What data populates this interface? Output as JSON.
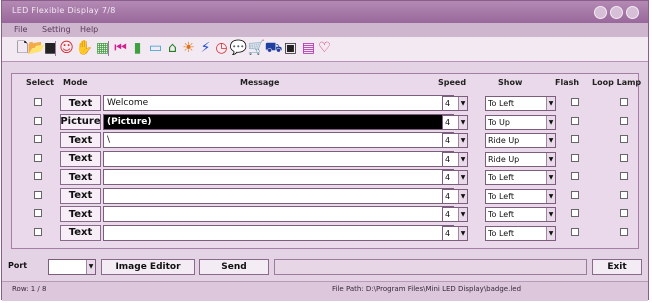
{
  "window": {
    "title": "LED Flexible Display 7/8"
  },
  "menu": [
    {
      "label": "File"
    },
    {
      "label": "Setting"
    },
    {
      "label": "Help"
    }
  ],
  "toolbar_icons": [
    {
      "name": "new-file-icon",
      "glyph": "🗋",
      "color": "#111111"
    },
    {
      "name": "open-folder-icon",
      "glyph": "📂",
      "color": "#8a6a2a"
    },
    {
      "name": "save-disk-icon",
      "glyph": "■",
      "color": "#222222"
    },
    {
      "name": "smiley-icon",
      "glyph": "☺",
      "color": "#d03030"
    },
    {
      "name": "hand-icon",
      "glyph": "✋",
      "color": "#c8a040"
    },
    {
      "name": "grid-icon",
      "glyph": "▦",
      "color": "#40a040"
    },
    {
      "name": "rewind-icon",
      "glyph": "⏮",
      "color": "#d02090"
    },
    {
      "name": "battery-icon",
      "glyph": "▮",
      "color": "#40a040"
    },
    {
      "name": "screen-icon",
      "glyph": "▭",
      "color": "#2f9fd0"
    },
    {
      "name": "house-icon",
      "glyph": "⌂",
      "color": "#208020"
    },
    {
      "name": "sun-icon",
      "glyph": "☀",
      "color": "#e07010"
    },
    {
      "name": "lightning-icon",
      "glyph": "⚡",
      "color": "#2050d0"
    },
    {
      "name": "clock-icon",
      "glyph": "◷",
      "color": "#d03030"
    },
    {
      "name": "speech-bubble-icon",
      "glyph": "💬",
      "color": "#6a40c0"
    },
    {
      "name": "cart-icon",
      "glyph": "🛒",
      "color": "#40a040"
    },
    {
      "name": "binoculars-icon",
      "glyph": "⛟",
      "color": "#2040a0"
    },
    {
      "name": "monitor-icon",
      "glyph": "▣",
      "color": "#222222"
    },
    {
      "name": "disk-icon",
      "glyph": "▤",
      "color": "#b020b0"
    },
    {
      "name": "heart-icon",
      "glyph": "♡",
      "color": "#d02060"
    }
  ],
  "columns": {
    "select": "Select",
    "mode": "Mode",
    "message": "Message",
    "speed": "Speed",
    "show": "Show",
    "flash": "Flash",
    "loop_lamp": "Loop Lamp"
  },
  "rows": [
    {
      "selected": false,
      "mode": "Text",
      "message": "Welcome",
      "speed": "4",
      "show": "To Left",
      "message_selected": false
    },
    {
      "selected": false,
      "mode": "Picture",
      "message": "(Picture)",
      "speed": "4",
      "show": "To Up",
      "message_selected": true
    },
    {
      "selected": false,
      "mode": "Text",
      "message": "\\",
      "speed": "4",
      "show": "Ride Up",
      "message_selected": false
    },
    {
      "selected": false,
      "mode": "Text",
      "message": "",
      "speed": "4",
      "show": "Ride Up",
      "message_selected": false
    },
    {
      "selected": false,
      "mode": "Text",
      "message": "",
      "speed": "4",
      "show": "To Left",
      "message_selected": false
    },
    {
      "selected": false,
      "mode": "Text",
      "message": "",
      "speed": "4",
      "show": "To Left",
      "message_selected": false
    },
    {
      "selected": false,
      "mode": "Text",
      "message": "",
      "speed": "4",
      "show": "To Left",
      "message_selected": false
    },
    {
      "selected": false,
      "mode": "Text",
      "message": "",
      "speed": "4",
      "show": "To Left",
      "message_selected": false
    }
  ],
  "bottom": {
    "port_label": "Port",
    "port_value": "",
    "image_editor_label": "Image Editor",
    "send_label": "Send",
    "exit_label": "Exit"
  },
  "status": {
    "left": "Row: 1 / 8",
    "right": "File Path: D:\\Program Files\\Mini LED Display\\badge.led"
  }
}
